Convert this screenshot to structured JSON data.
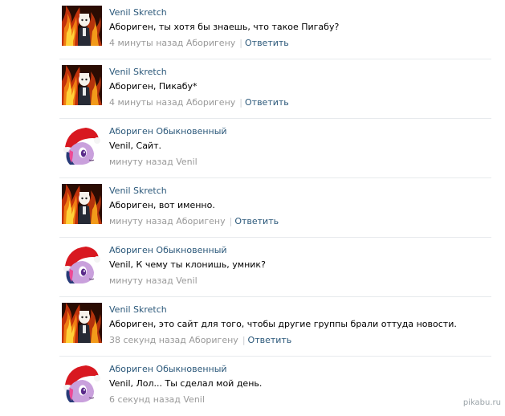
{
  "comments": [
    {
      "author": "Venil Skretch",
      "text": "Абориген, ты хотя бы знаешь, что такое Пигабу?",
      "meta": "4 минуты назад Аборигену",
      "reply": "Ответить",
      "avatar_icon": "fire-character-avatar"
    },
    {
      "author": "Venil Skretch",
      "text": "Абориген, Пикабу*",
      "meta": "4 минуты назад Аборигену",
      "reply": "Ответить",
      "avatar_icon": "fire-character-avatar"
    },
    {
      "author": "Абориген Обыкновенный",
      "text": "Venil, Сайт.",
      "meta": "минуту назад Venil",
      "reply": "",
      "avatar_icon": "pony-santa-hat-avatar"
    },
    {
      "author": "Venil Skretch",
      "text": "Абориген, вот именно.",
      "meta": "минуту назад Аборигену",
      "reply": "Ответить",
      "avatar_icon": "fire-character-avatar"
    },
    {
      "author": "Абориген Обыкновенный",
      "text": "Venil, К чему ты клонишь, умник?",
      "meta": "минуту назад Venil",
      "reply": "",
      "avatar_icon": "pony-santa-hat-avatar"
    },
    {
      "author": "Venil Skretch",
      "text": "Абориген, это сайт для того, чтобы другие группы брали оттуда новости.",
      "meta": "38 секунд назад Аборигену",
      "reply": "Ответить",
      "avatar_icon": "fire-character-avatar"
    },
    {
      "author": "Абориген Обыкновенный",
      "text": "Venil, Лол... Ты сделал мой день.",
      "meta": "6 секунд назад Venil",
      "reply": "",
      "avatar_icon": "pony-santa-hat-avatar"
    }
  ],
  "watermark": "pikabu.ru",
  "colors": {
    "link": "#2b587a",
    "meta": "#999999",
    "separator": "#e7eaed"
  }
}
